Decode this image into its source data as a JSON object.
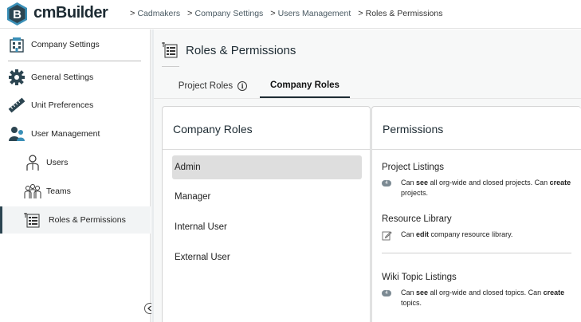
{
  "app": {
    "name": "cmBuilder",
    "logo_letter": "B"
  },
  "breadcrumb": [
    {
      "label": "Cadmakers"
    },
    {
      "label": "Company Settings"
    },
    {
      "label": "Users Management"
    },
    {
      "label": "Roles & Permissions"
    }
  ],
  "sidebar": {
    "items": [
      {
        "label": "Company Settings",
        "icon": "building-icon"
      },
      {
        "label": "General Settings",
        "icon": "gear-icon"
      },
      {
        "label": "Unit Preferences",
        "icon": "ruler-icon"
      },
      {
        "label": "User Management",
        "icon": "user-group-icon"
      },
      {
        "label": "Users",
        "icon": "user-icon"
      },
      {
        "label": "Teams",
        "icon": "team-icon"
      },
      {
        "label": "Roles & Permissions",
        "icon": "roles-icon",
        "active": true
      }
    ],
    "collapse_icon": "chevron-left-icon"
  },
  "page": {
    "title": "Roles & Permissions",
    "icon": "roles-icon"
  },
  "tabs": [
    {
      "label": "Project Roles",
      "active": false,
      "icon": "info-icon"
    },
    {
      "label": "Company Roles",
      "active": true
    }
  ],
  "roles_panel": {
    "title": "Company Roles",
    "roles": [
      {
        "label": "Admin",
        "selected": true
      },
      {
        "label": "Manager"
      },
      {
        "label": "Internal User"
      },
      {
        "label": "External User"
      }
    ]
  },
  "permissions_panel": {
    "title": "Permissions",
    "sections": [
      {
        "title": "Project Listings",
        "badge": "4",
        "text": {
          "a": "Can ",
          "b": "see",
          "c": " all org-wide and closed projects. Can ",
          "d": "create",
          "e": " projects."
        }
      },
      {
        "title": "Resource Library",
        "icon": "edit-icon",
        "text": {
          "a": "Can ",
          "b": "edit",
          "c": " company resource library."
        }
      },
      {
        "title": "Wiki Topic Listings",
        "badge": "4",
        "text": {
          "a": "Can ",
          "b": "see",
          "c": " all org-wide and closed topics. Can ",
          "d": "create",
          "e": " topics."
        }
      }
    ]
  },
  "colors": {
    "brand_dark": "#2c4551",
    "accent_teal": "#3a8fb7",
    "selected_bg": "#dedede"
  }
}
